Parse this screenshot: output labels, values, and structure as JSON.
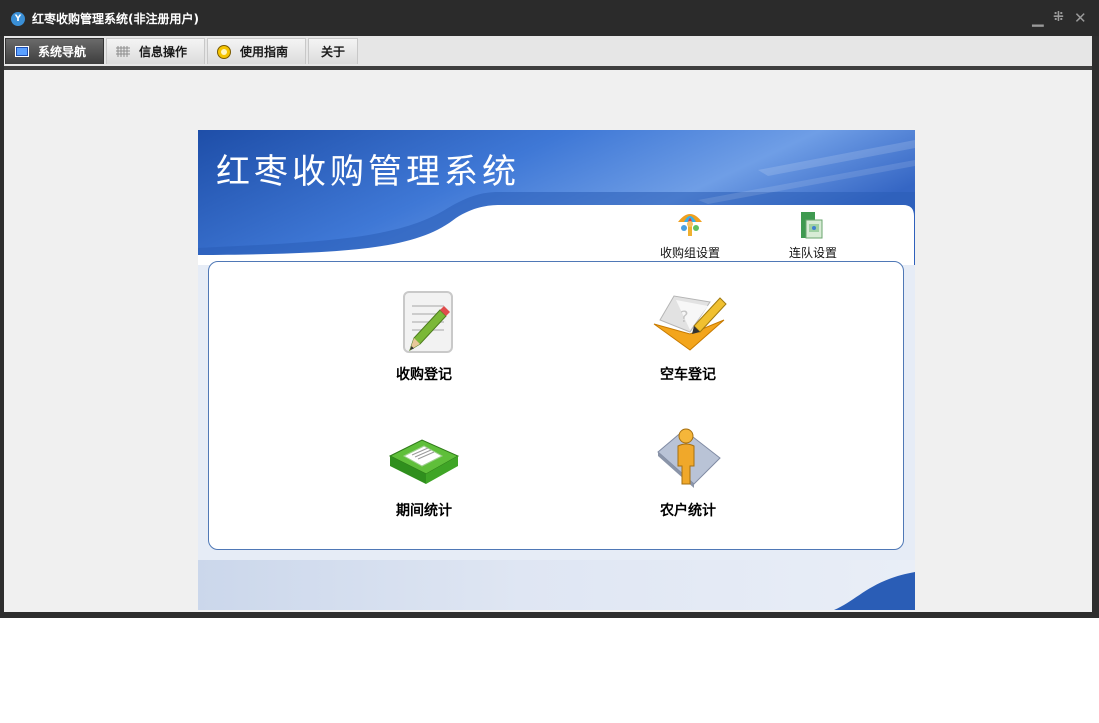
{
  "window": {
    "title": "红枣收购管理系统(非注册用户)",
    "controls": {
      "minimize": "▁",
      "restore": "⁜",
      "close": "✕"
    }
  },
  "tabs": [
    {
      "label": "系统导航",
      "icon": "monitor-icon",
      "active": true
    },
    {
      "label": "信息操作",
      "icon": "grid-icon",
      "active": false
    },
    {
      "label": "使用指南",
      "icon": "help-icon",
      "active": false
    },
    {
      "label": "关于",
      "icon": "",
      "active": false
    }
  ],
  "panel": {
    "title": "红枣收购管理系统",
    "top_buttons": [
      {
        "label": "收购组设置",
        "icon": "umbrella-group-icon"
      },
      {
        "label": "连队设置",
        "icon": "book-settings-icon"
      }
    ],
    "menu_items": [
      {
        "label": "收购登记",
        "icon": "notepad-pencil-icon"
      },
      {
        "label": "空车登记",
        "icon": "folder-pencil-icon"
      },
      {
        "label": "期间统计",
        "icon": "green-book-icon"
      },
      {
        "label": "农户统计",
        "icon": "person-icon"
      }
    ]
  },
  "colors": {
    "accent": "#2a5db6",
    "banner_light": "#5b8fe0",
    "border": "#4f78b6"
  }
}
